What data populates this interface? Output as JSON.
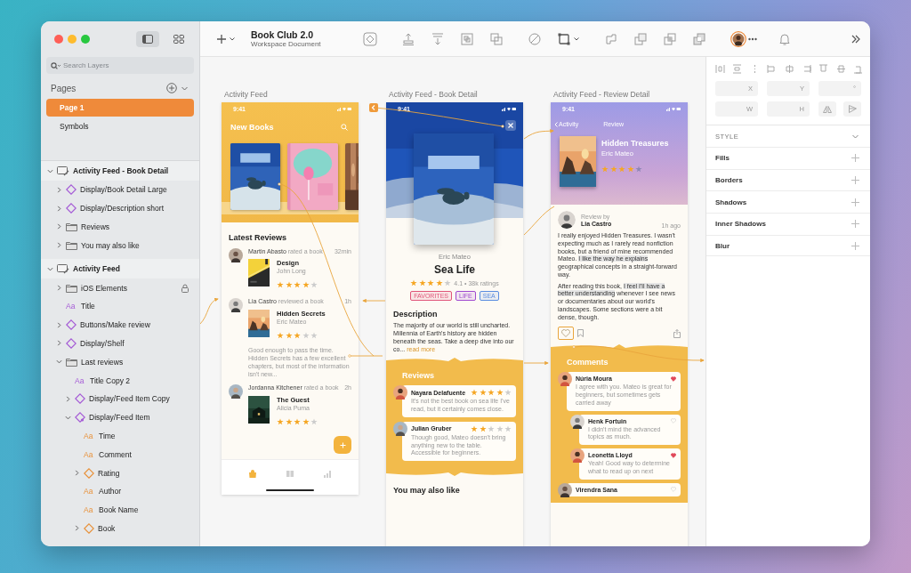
{
  "window": {
    "title": "Book Club 2.0",
    "subtitle": "Workspace Document"
  },
  "sidebar": {
    "search_placeholder": "Search Layers",
    "pages_title": "Pages",
    "pages": [
      {
        "label": "Page 1",
        "selected": true
      },
      {
        "label": "Symbols",
        "selected": false
      }
    ],
    "layers": [
      {
        "name": "Activity Feed - Book Detail",
        "kind": "artboard",
        "expanded": true,
        "locked": false,
        "children": [
          {
            "name": "Display/Book Detail Large",
            "kind": "symbol",
            "expanded": false,
            "locked": false
          },
          {
            "name": "Display/Description short",
            "kind": "symbol",
            "expanded": false,
            "locked": false
          },
          {
            "name": "Reviews",
            "kind": "group",
            "expanded": false,
            "locked": false
          },
          {
            "name": "You may also like",
            "kind": "group",
            "expanded": false,
            "locked": false
          }
        ]
      },
      {
        "name": "Activity Feed",
        "kind": "artboard",
        "expanded": true,
        "locked": false,
        "children": [
          {
            "name": "iOS Elements",
            "kind": "group",
            "expanded": false,
            "locked": true
          },
          {
            "name": "Title",
            "kind": "text",
            "icon": "Aa",
            "locked": false
          },
          {
            "name": "Buttons/Make review",
            "kind": "symbol",
            "expanded": false,
            "locked": false
          },
          {
            "name": "Display/Shelf",
            "kind": "symbol",
            "expanded": false,
            "locked": false
          },
          {
            "name": "Last reviews",
            "kind": "group",
            "expanded": true,
            "locked": false,
            "children": [
              {
                "name": "Title Copy 2",
                "kind": "text",
                "icon": "Aa",
                "locked": false
              },
              {
                "name": "Display/Feed Item Copy",
                "kind": "symbol",
                "expanded": false,
                "locked": false
              },
              {
                "name": "Display/Feed Item",
                "kind": "symbol_edited",
                "expanded": true,
                "locked": false,
                "children": [
                  {
                    "name": "Time",
                    "kind": "override_text",
                    "icon": "Aa",
                    "locked": false
                  },
                  {
                    "name": "Comment",
                    "kind": "override_text",
                    "icon": "Aa",
                    "locked": false
                  },
                  {
                    "name": "Rating",
                    "kind": "override_symbol",
                    "expanded": false,
                    "locked": false
                  },
                  {
                    "name": "Author",
                    "kind": "override_text",
                    "icon": "Aa",
                    "locked": false
                  },
                  {
                    "name": "Book Name",
                    "kind": "override_text",
                    "icon": "Aa",
                    "locked": false
                  },
                  {
                    "name": "Book",
                    "kind": "override_symbol",
                    "expanded": false,
                    "locked": false
                  }
                ]
              }
            ]
          }
        ]
      }
    ]
  },
  "inspector": {
    "position_fields": [
      {
        "label": "X"
      },
      {
        "label": "Y"
      },
      {
        "label": "°"
      }
    ],
    "size_fields": [
      {
        "label": "W"
      },
      {
        "label": "H"
      }
    ],
    "style_title": "STYLE",
    "sections": [
      "Fills",
      "Borders",
      "Shadows",
      "Inner Shadows",
      "Blur"
    ]
  },
  "activity_feed": {
    "label": "Activity Feed",
    "time": "9:41",
    "title": "New Books",
    "section_title": "Latest Reviews",
    "feed": [
      {
        "user": "Martin Abasto",
        "action": "rated a book",
        "time": "32min",
        "book": "Design",
        "author": "John Long",
        "stars": 4
      },
      {
        "user": "Lia Castro",
        "action": "reviewed a book",
        "time": "1h",
        "book": "Hidden Secrets",
        "author": "Eric Mateo",
        "stars": 3,
        "comment": "Good enough to pass the time. Hidden Secrets has a few excellent chapters, but most of the information isn't new..."
      },
      {
        "user": "Jordanna Kitchener",
        "action": "rated a book",
        "time": "2h",
        "book": "The Guest",
        "author": "Alicia Puma",
        "stars": 4
      }
    ],
    "tabs": [
      {
        "selected": true
      },
      {
        "selected": false
      },
      {
        "selected": false
      }
    ]
  },
  "book_detail": {
    "label": "Activity Feed - Book Detail",
    "time": "9:41",
    "author": "Eric Mateo",
    "title": "Sea Life",
    "stars": 4,
    "rating": "4.1 • 38k ratings",
    "tags": [
      {
        "label": "FAVORITES",
        "color": "#e0567a"
      },
      {
        "label": "LIFE",
        "color": "#a04ad0"
      },
      {
        "label": "SEA",
        "color": "#5a8de0"
      }
    ],
    "description_title": "Description",
    "description": "The majority of our world is still uncharted. Millennia of Earth's history are hidden beneath the seas. Take a deep dive into our co...",
    "read_more": "read more",
    "reviews_title": "Reviews",
    "reviews": [
      {
        "name": "Nayara Delafuente",
        "stars": 4,
        "text": "It's not the best book on sea life I've read, but it certainly comes close."
      },
      {
        "name": "Julian Gruber",
        "stars": 2,
        "text": "Though good, Mateo doesn't bring anything new to the table. Accessible for beginners."
      }
    ],
    "more_title": "You may also like"
  },
  "review_detail": {
    "label": "Activity Feed - Review Detail",
    "time": "9:41",
    "back": "Activity",
    "nav_title": "Review",
    "book_title": "Hidden Treasures",
    "author": "Eric Mateo",
    "stars": 4,
    "review_by": "Review by",
    "reviewer": "Lia Castro",
    "ago": "1h ago",
    "paragraphs": [
      [
        {
          "text": "I really enjoyed Hidden Treasures. I wasn't expecting much as I rarely read nonfiction books, but a friend of mine recommended Mateo. ",
          "highlighted": false
        },
        {
          "text": "I like the way he explains",
          "highlighted": true
        },
        {
          "text": " geographical concepts in a straight-forward way.",
          "highlighted": false
        }
      ],
      [
        {
          "text": "After reading this book, ",
          "highlighted": false
        },
        {
          "text": "I feel I'll have a better understanding",
          "highlighted": true
        },
        {
          "text": " whenever I see news or documentaries about our world's landscapes. Some sections were a bit dense, though.",
          "highlighted": false
        }
      ]
    ],
    "comments_title": "Comments",
    "comments": [
      {
        "name": "Núria Moura",
        "liked": true,
        "text": "I agree with you. Mateo is great for beginners, but sometimes gets carried away",
        "children": [
          {
            "name": "Henk Fortuin",
            "liked": false,
            "text": "I didn't mind the advanced topics as much."
          },
          {
            "name": "Leonetta Lloyd",
            "liked": true,
            "text": "Yeah! Good way to determine what to read up on next"
          }
        ]
      },
      {
        "name": "Virendra Sana",
        "liked": false
      }
    ]
  }
}
